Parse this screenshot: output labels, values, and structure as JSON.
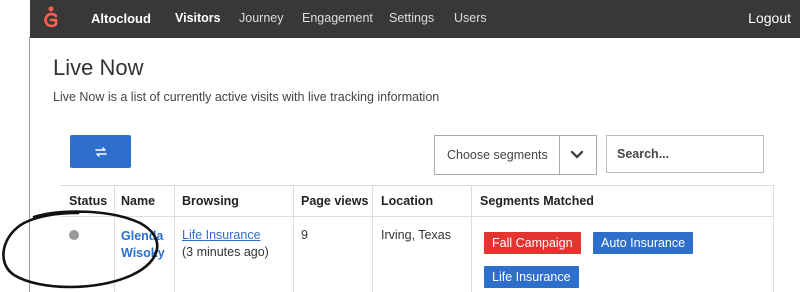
{
  "colors": {
    "topbar": "#383838",
    "accent": "#2e6fcc",
    "danger": "#e3342f",
    "logo": "#ff5f4f"
  },
  "app": {
    "brand": "Altocloud",
    "logout": "Logout"
  },
  "nav": [
    {
      "label": "Visitors",
      "active": true
    },
    {
      "label": "Journey"
    },
    {
      "label": "Engagement"
    },
    {
      "label": "Settings"
    },
    {
      "label": "Users"
    }
  ],
  "page": {
    "title": "Live Now",
    "subtitle": "Live Now is a list of currently active visits with live tracking information"
  },
  "controls": {
    "refresh_icon": "refresh-icon",
    "segments_label": "Choose segments",
    "search_placeholder": "Search..."
  },
  "table": {
    "headers": [
      "Status",
      "Name",
      "Browsing",
      "Page views",
      "Location",
      "Segments Matched"
    ],
    "rows": [
      {
        "status": "inactive",
        "name_line1": "Glenda",
        "name_line2": "Wisoky",
        "browsing_page": "Life Insurance",
        "browsing_time": "(3 minutes ago)",
        "page_views": "9",
        "location": "Irving, Texas",
        "segments": [
          "Fall Campaign",
          "Auto Insurance",
          "Life Insurance"
        ]
      }
    ]
  }
}
